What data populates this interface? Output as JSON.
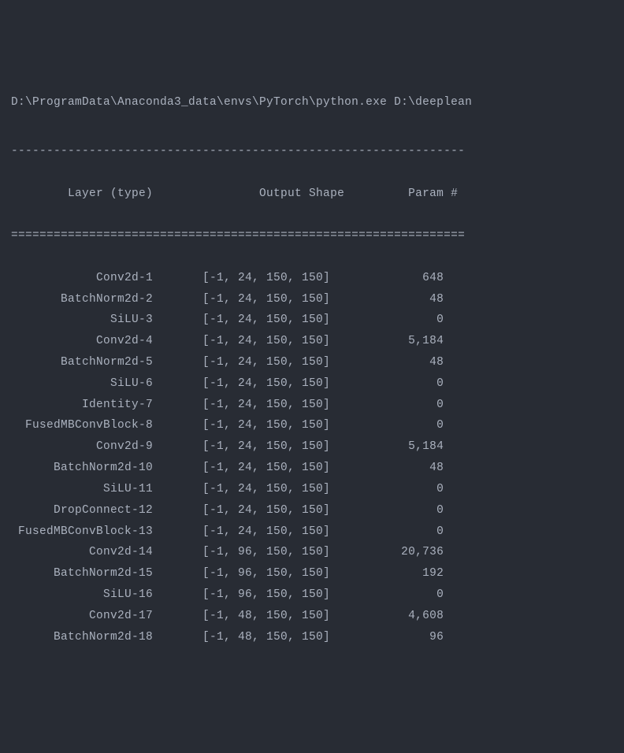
{
  "terminal": {
    "command_line": "D:\\ProgramData\\Anaconda3_data\\envs\\PyTorch\\python.exe D:\\deeplean",
    "separator_dash": "----------------------------------------------------------------",
    "separator_equal": "================================================================",
    "header_line": "        Layer (type)               Output Shape         Param #",
    "rows": [
      {
        "layer": "            Conv2d-1",
        "shape": "       [-1, 24, 150, 150]",
        "param": "             648"
      },
      {
        "layer": "       BatchNorm2d-2",
        "shape": "       [-1, 24, 150, 150]",
        "param": "              48"
      },
      {
        "layer": "              SiLU-3",
        "shape": "       [-1, 24, 150, 150]",
        "param": "               0"
      },
      {
        "layer": "            Conv2d-4",
        "shape": "       [-1, 24, 150, 150]",
        "param": "           5,184"
      },
      {
        "layer": "       BatchNorm2d-5",
        "shape": "       [-1, 24, 150, 150]",
        "param": "              48"
      },
      {
        "layer": "              SiLU-6",
        "shape": "       [-1, 24, 150, 150]",
        "param": "               0"
      },
      {
        "layer": "          Identity-7",
        "shape": "       [-1, 24, 150, 150]",
        "param": "               0"
      },
      {
        "layer": "  FusedMBConvBlock-8",
        "shape": "       [-1, 24, 150, 150]",
        "param": "               0"
      },
      {
        "layer": "            Conv2d-9",
        "shape": "       [-1, 24, 150, 150]",
        "param": "           5,184"
      },
      {
        "layer": "      BatchNorm2d-10",
        "shape": "       [-1, 24, 150, 150]",
        "param": "              48"
      },
      {
        "layer": "             SiLU-11",
        "shape": "       [-1, 24, 150, 150]",
        "param": "               0"
      },
      {
        "layer": "      DropConnect-12",
        "shape": "       [-1, 24, 150, 150]",
        "param": "               0"
      },
      {
        "layer": " FusedMBConvBlock-13",
        "shape": "       [-1, 24, 150, 150]",
        "param": "               0"
      },
      {
        "layer": "           Conv2d-14",
        "shape": "       [-1, 96, 150, 150]",
        "param": "          20,736"
      },
      {
        "layer": "      BatchNorm2d-15",
        "shape": "       [-1, 96, 150, 150]",
        "param": "             192"
      },
      {
        "layer": "             SiLU-16",
        "shape": "       [-1, 96, 150, 150]",
        "param": "               0"
      },
      {
        "layer": "           Conv2d-17",
        "shape": "       [-1, 48, 150, 150]",
        "param": "           4,608"
      },
      {
        "layer": "      BatchNorm2d-18",
        "shape": "       [-1, 48, 150, 150]",
        "param": "              96"
      }
    ]
  }
}
